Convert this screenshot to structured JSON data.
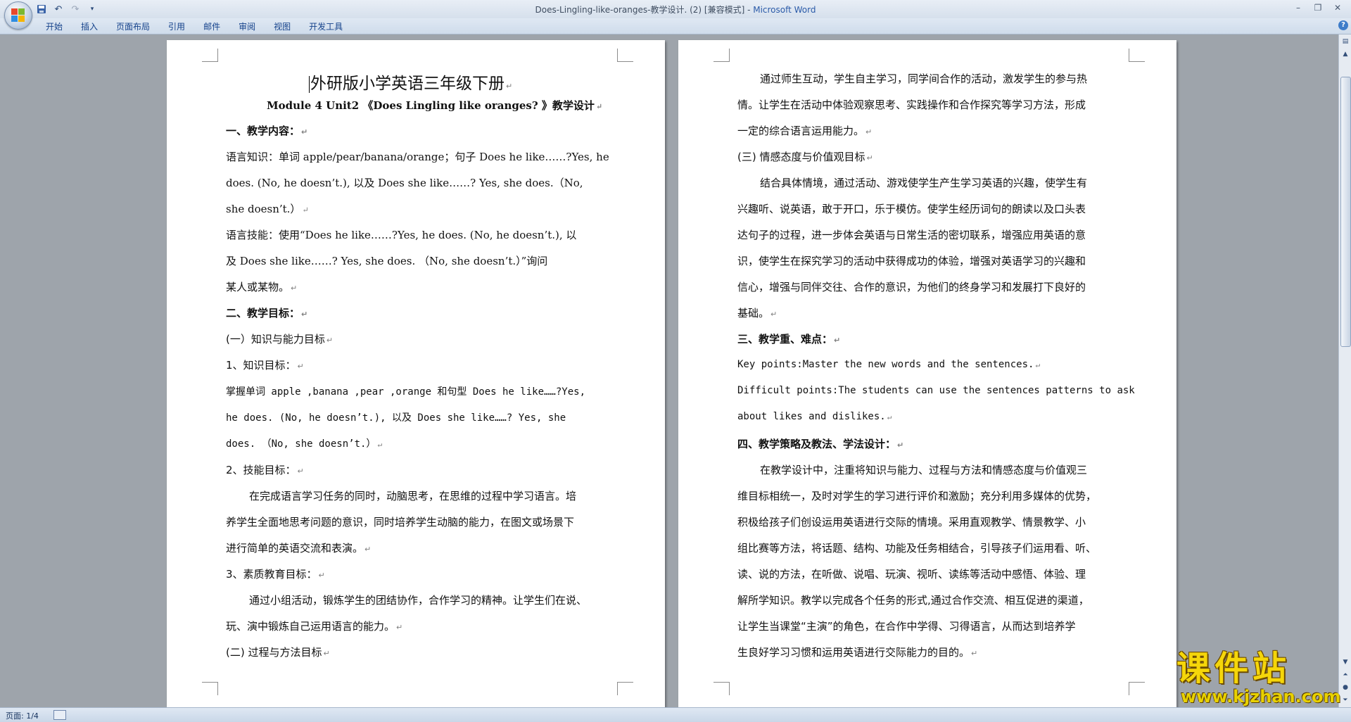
{
  "window": {
    "title_doc": "Does-Lingling-like-oranges-教学设计. (2) [兼容模式] - ",
    "title_app": "Microsoft Word"
  },
  "quick_access": {
    "save_icon": "save-icon",
    "undo_icon": "undo-icon",
    "redo_icon": "redo-icon",
    "customize_icon": "dropdown-icon"
  },
  "ribbon": {
    "tabs": [
      "开始",
      "插入",
      "页面布局",
      "引用",
      "邮件",
      "审阅",
      "视图",
      "开发工具"
    ],
    "help": "?"
  },
  "page1": {
    "title": "外研版小学英语三年级下册",
    "subtitle": "Module 4 Unit2 《Does Lingling like oranges? 》教学设计",
    "lines": [
      "一、教学内容：",
      "语言知识：单词 apple/pear/banana/orange；句子 Does   he   like……?Yes, he",
      "does. (No, he doesn’t.), 以及 Does   she   like……? Yes, she     does.（No,",
      "she   doesn’t.）",
      "语言技能：使用“Does   he   like……?Yes, he   does. (No, he doesn’t.), 以",
      "及 Does   she   like……? Yes, she     does. （No, she   doesn’t.）”询问",
      "某人或某物。",
      "二、教学目标：",
      "(一）知识与能力目标",
      "1、知识目标：",
      "掌握单词 apple ,banana ,pear ,orange 和句型 Does  he  like……?Yes,",
      "he  does. (No, he doesn’t.), 以及 Does  she  like……? Yes, she",
      "does. （No, she  doesn’t.）",
      "2、技能目标：",
      "在完成语言学习任务的同时，动脑思考，在思维的过程中学习语言。培",
      "养学生全面地思考问题的意识，同时培养学生动脑的能力，在图文或场景下",
      "进行简单的英语交流和表演。",
      "3、素质教育目标：",
      "通过小组活动，锻炼学生的团结协作，合作学习的精神。让学生们在说、",
      "玩、演中锻炼自己运用语言的能力。",
      "(二) 过程与方法目标"
    ]
  },
  "page2": {
    "lines": [
      "通过师生互动，学生自主学习，同学间合作的活动，激发学生的参与热",
      "情。让学生在活动中体验观察思考、实践操作和合作探究等学习方法，形成",
      "一定的综合语言运用能力。",
      "(三) 情感态度与价值观目标",
      "结合具体情境，通过活动、游戏使学生产生学习英语的兴趣，使学生有",
      "兴趣听、说英语，敢于开口，乐于模仿。使学生经历词句的朗读以及口头表",
      "达句子的过程，进一步体会英语与日常生活的密切联系，增强应用英语的意",
      "识，使学生在探究学习的活动中获得成功的体验，增强对英语学习的兴趣和",
      "信心，增强与同伴交往、合作的意识，为他们的终身学习和发展打下良好的",
      "基础。",
      "三、教学重、难点：",
      "Key points:Master the new words and the sentences.",
      "Difficult points:The students can use the sentences patterns to ask",
      "about likes and dislikes.",
      "四、教学策略及教法、学法设计：",
      "在教学设计中，注重将知识与能力、过程与方法和情感态度与价值观三",
      "维目标相统一，及时对学生的学习进行评价和激励；充分利用多媒体的优势，",
      "积极给孩子们创设运用英语进行交际的情境。采用直观教学、情景教学、小",
      "组比赛等方法，将话题、结构、功能及任务相结合，引导孩子们运用看、听、",
      "读、说的方法，在听做、说唱、玩演、视听、读练等活动中感悟、体验、理",
      "解所学知识。教学以完成各个任务的形式,通过合作交流、相互促进的渠道，",
      "让学生当课堂“主演”的角色，在合作中学得、习得语言，从而达到培养学",
      "生良好学习习惯和运用英语进行交际能力的目的。"
    ]
  },
  "status": {
    "page": "页面: 1/4"
  },
  "watermark": {
    "title": "课件站",
    "url": "www.kjzhan.com"
  },
  "colors": {
    "app_title": "#2a5aa8",
    "ribbon_text": "#15428b",
    "watermark": "#f5d60a"
  }
}
